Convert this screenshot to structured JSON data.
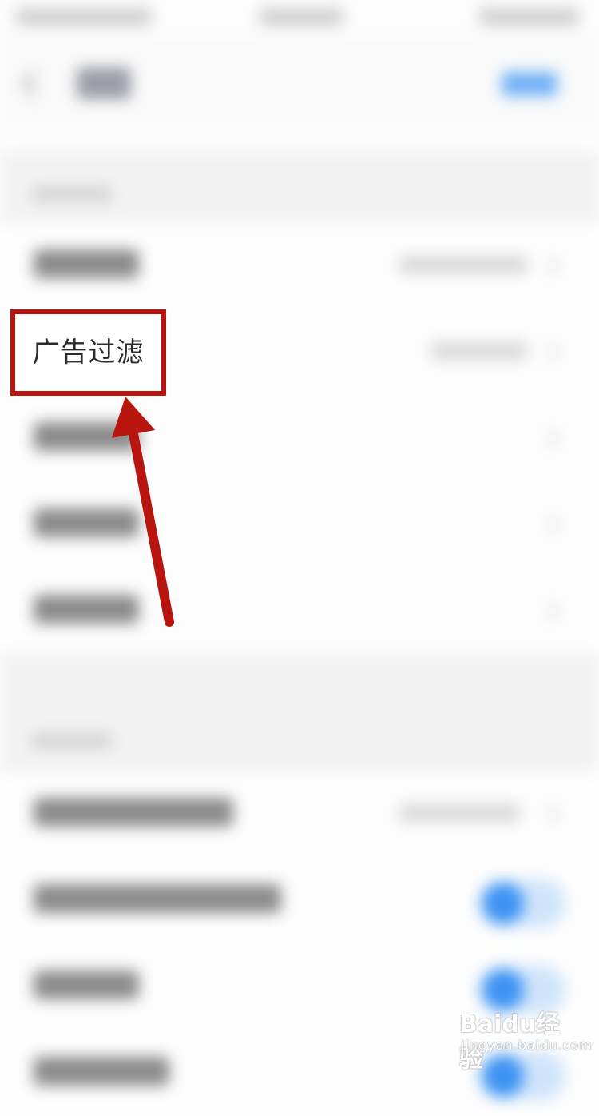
{
  "highlight": {
    "label": "广告过滤"
  },
  "watermark": {
    "logo_text": "Baidu经验",
    "url": "jingyan.baidu.com"
  },
  "colors": {
    "highlight_border": "#b8150f",
    "arrow": "#b8150f",
    "toggle_on": "#3c93f3",
    "nav_action": "#6fb1f6"
  },
  "icons": [
    "back-chevron-icon",
    "row-chevron-icon",
    "toggle-switch",
    "paw-icon"
  ]
}
